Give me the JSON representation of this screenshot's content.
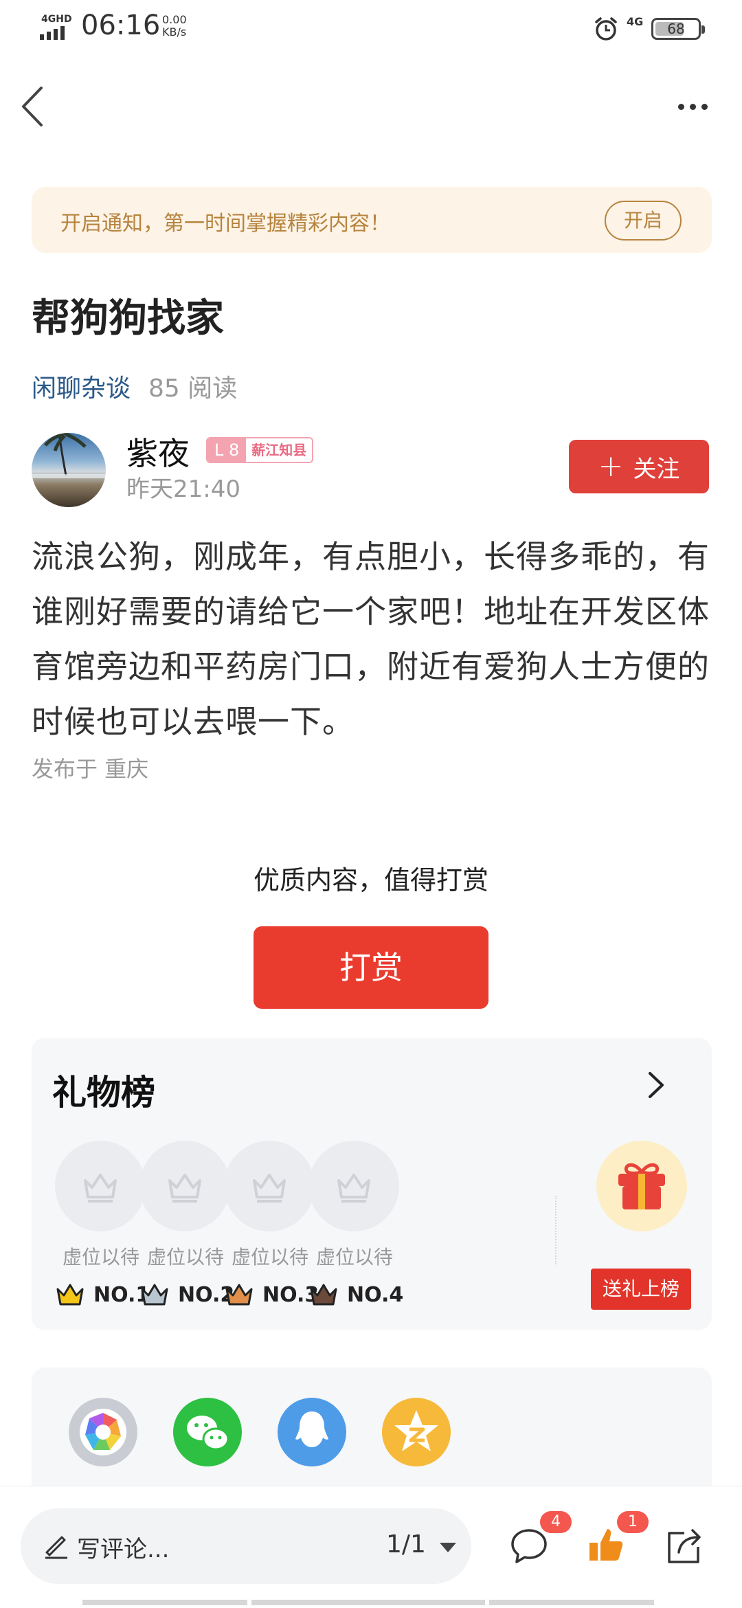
{
  "status_bar": {
    "network": "4GHD",
    "time": "06:16",
    "speed_value": "0.00",
    "speed_unit": "KB/s",
    "mobile_net": "4G",
    "battery": "68",
    "battery_level": 0.68
  },
  "notice": {
    "text": "开启通知，第一时间掌握精彩内容！",
    "button": "开启"
  },
  "post": {
    "title": "帮狗狗找家",
    "category": "闲聊杂谈",
    "reads": "85 阅读",
    "body": "流浪公狗，刚成年，有点胆小，长得多乖的，有谁刚好需要的请给它一个家吧！地址在开发区体育馆旁边和平药房门口，附近有爱狗人士方便的时候也可以去喂一下。",
    "location": "发布于 重庆"
  },
  "author": {
    "name": "紫夜",
    "level": "L 8",
    "level_title": "薪江知县",
    "time": "昨天21:40",
    "follow_label": "关注"
  },
  "reward": {
    "prompt": "优质内容，值得打赏",
    "button": "打赏"
  },
  "gift_board": {
    "title": "礼物榜",
    "slots": [
      {
        "label": "虚位以待",
        "rank": "NO.1",
        "crown_color": "#f5c518"
      },
      {
        "label": "虚位以待",
        "rank": "NO.2",
        "crown_color": "#b9c6d2"
      },
      {
        "label": "虚位以待",
        "rank": "NO.3",
        "crown_color": "#e0904a"
      },
      {
        "label": "虚位以待",
        "rank": "NO.4",
        "crown_color": "#6b4a3c"
      }
    ],
    "send_button": "送礼上榜"
  },
  "share": {
    "items": [
      "camera-shutter-icon",
      "wechat-icon",
      "qq-icon",
      "qzone-icon"
    ]
  },
  "bottom_bar": {
    "comment_placeholder": "写评论...",
    "page": "1/1",
    "comments_count": "4",
    "likes_count": "1"
  }
}
